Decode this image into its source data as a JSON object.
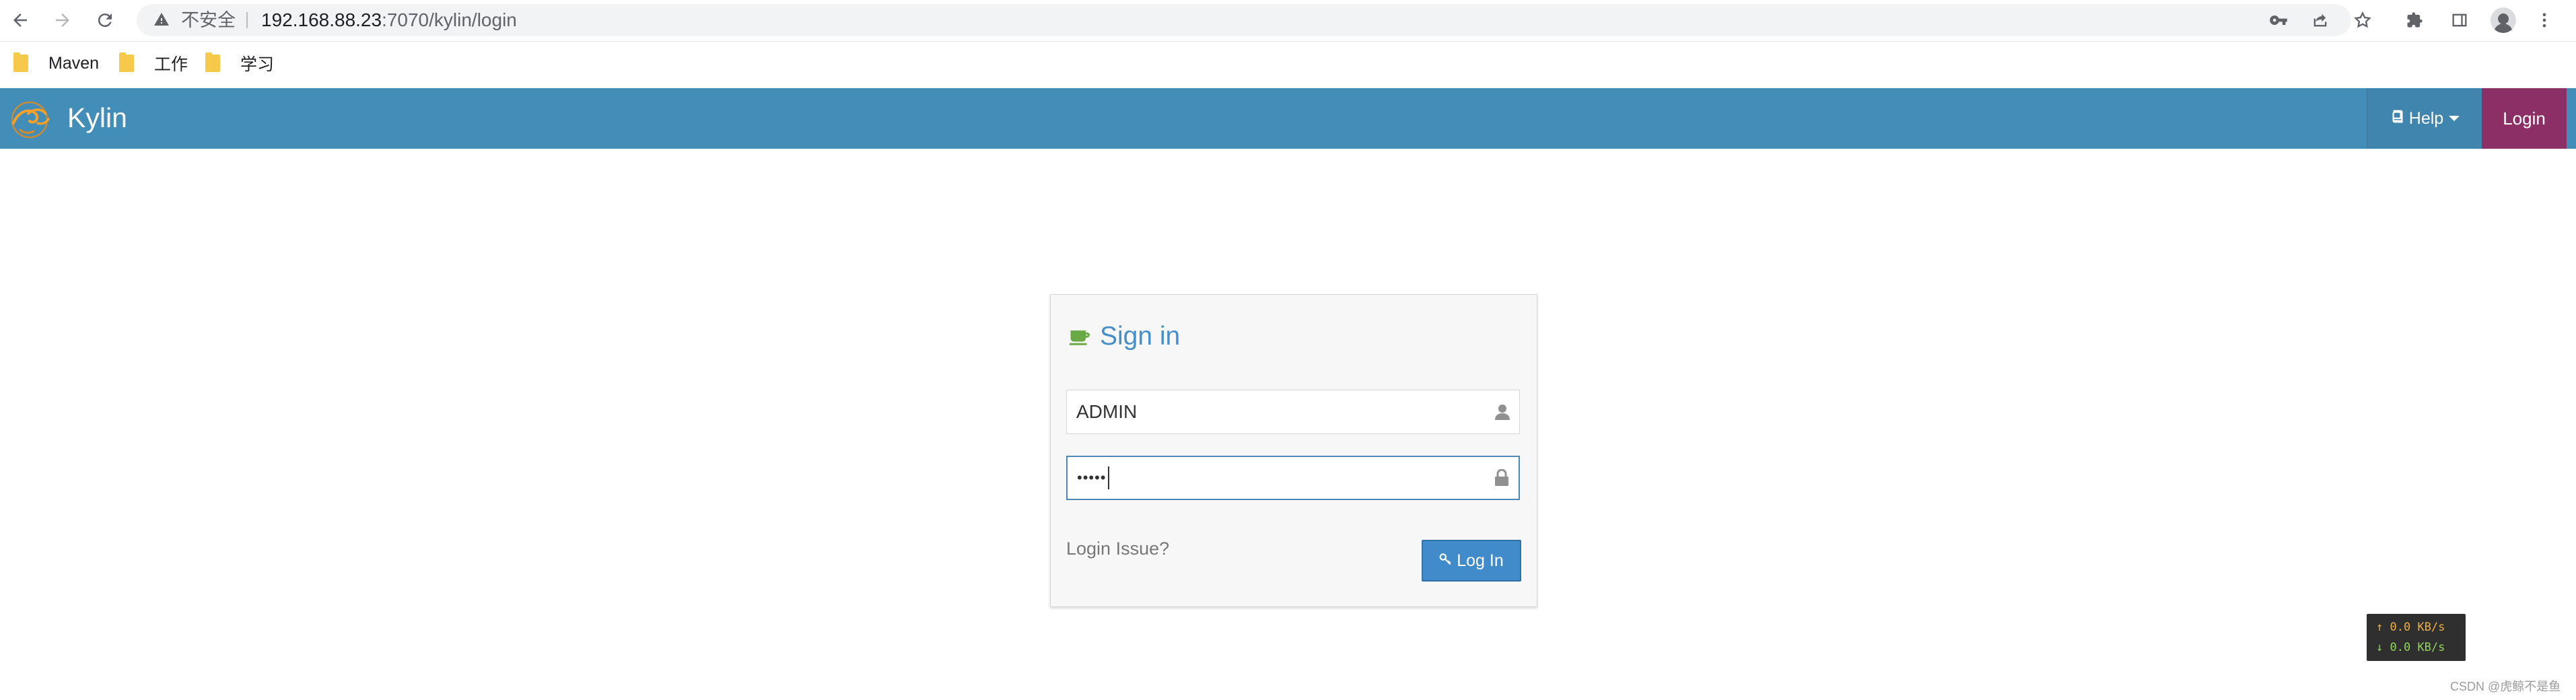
{
  "browser": {
    "security_label": "不安全",
    "url_host": "192.168.88.23",
    "url_path": ":7070/kylin/login",
    "icons": {
      "back": "arrow-left-icon",
      "forward": "arrow-right-icon",
      "reload": "reload-icon",
      "warning": "warning-triangle-icon",
      "key": "key-icon",
      "share": "share-icon",
      "star": "star-icon",
      "extensions": "puzzle-icon",
      "sidepanel": "side-panel-icon",
      "profile": "profile-icon",
      "menu": "kebab-menu-icon"
    },
    "bookmarks": [
      {
        "label": "Maven"
      },
      {
        "label": "工作"
      },
      {
        "label": "学习"
      }
    ]
  },
  "navbar": {
    "brand": "Kylin",
    "help_label": "Help",
    "login_label": "Login",
    "colors": {
      "bar": "#438eb9",
      "login_bg": "#8c2f67"
    }
  },
  "login_form": {
    "title": "Sign in",
    "username_value": "ADMIN",
    "password_mask": "•••••",
    "issue_link": "Login Issue?",
    "submit_label": "Log In",
    "colors": {
      "title": "#478fca",
      "button": "#428bca",
      "icon_green": "#69aa46"
    }
  },
  "network_widget": {
    "upload": "↑ 0.0 KB/s",
    "download": "↓ 0.0 KB/s"
  },
  "watermark": "CSDN @虎鲸不是鱼"
}
